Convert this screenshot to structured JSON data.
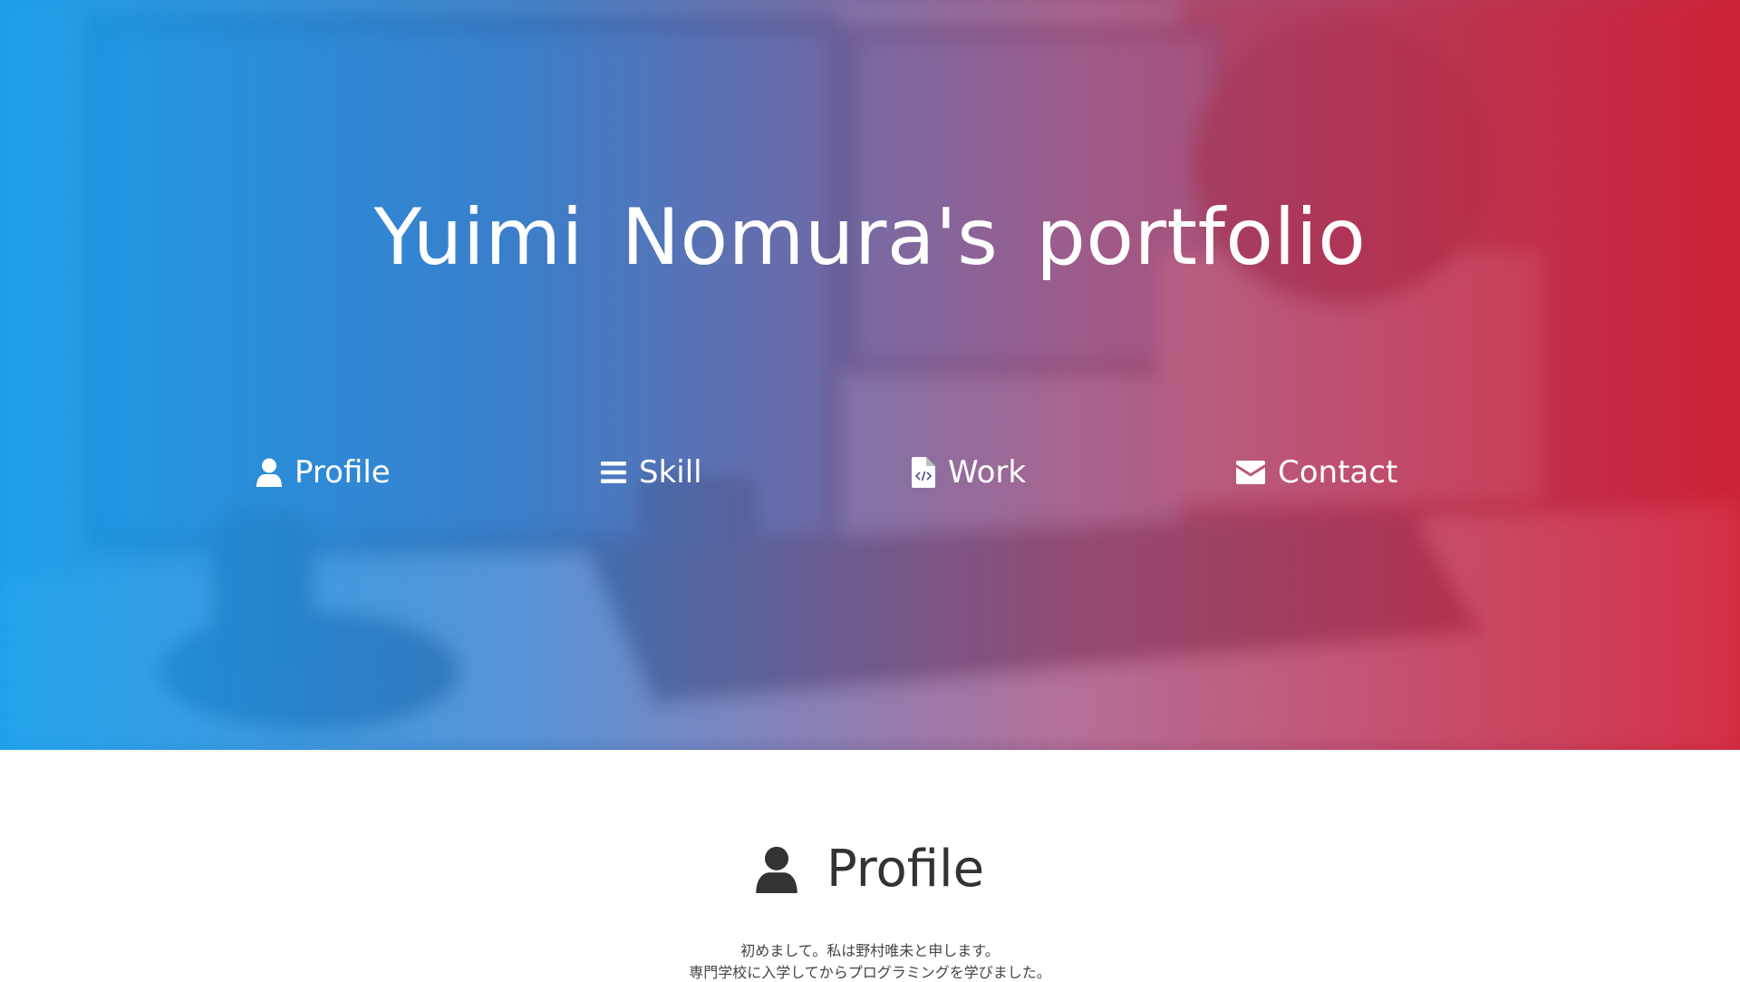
{
  "hero": {
    "title": "Yuimi  Nomura's  portfolio"
  },
  "nav": {
    "items": [
      {
        "label": "Profile",
        "icon": "user-icon"
      },
      {
        "label": "Skill",
        "icon": "bars-icon"
      },
      {
        "label": "Work",
        "icon": "code-file-icon"
      },
      {
        "label": "Contact",
        "icon": "envelope-icon"
      }
    ]
  },
  "profile": {
    "heading": "Profile",
    "icon": "user-icon",
    "lines": [
      "初めまして。私は野村唯未と申します。",
      "専門学校に入学してからプログラミングを学びました。"
    ]
  },
  "colors": {
    "gradient_left": "#16a0ee",
    "gradient_right": "#d61e34",
    "text_dark": "#333333"
  }
}
